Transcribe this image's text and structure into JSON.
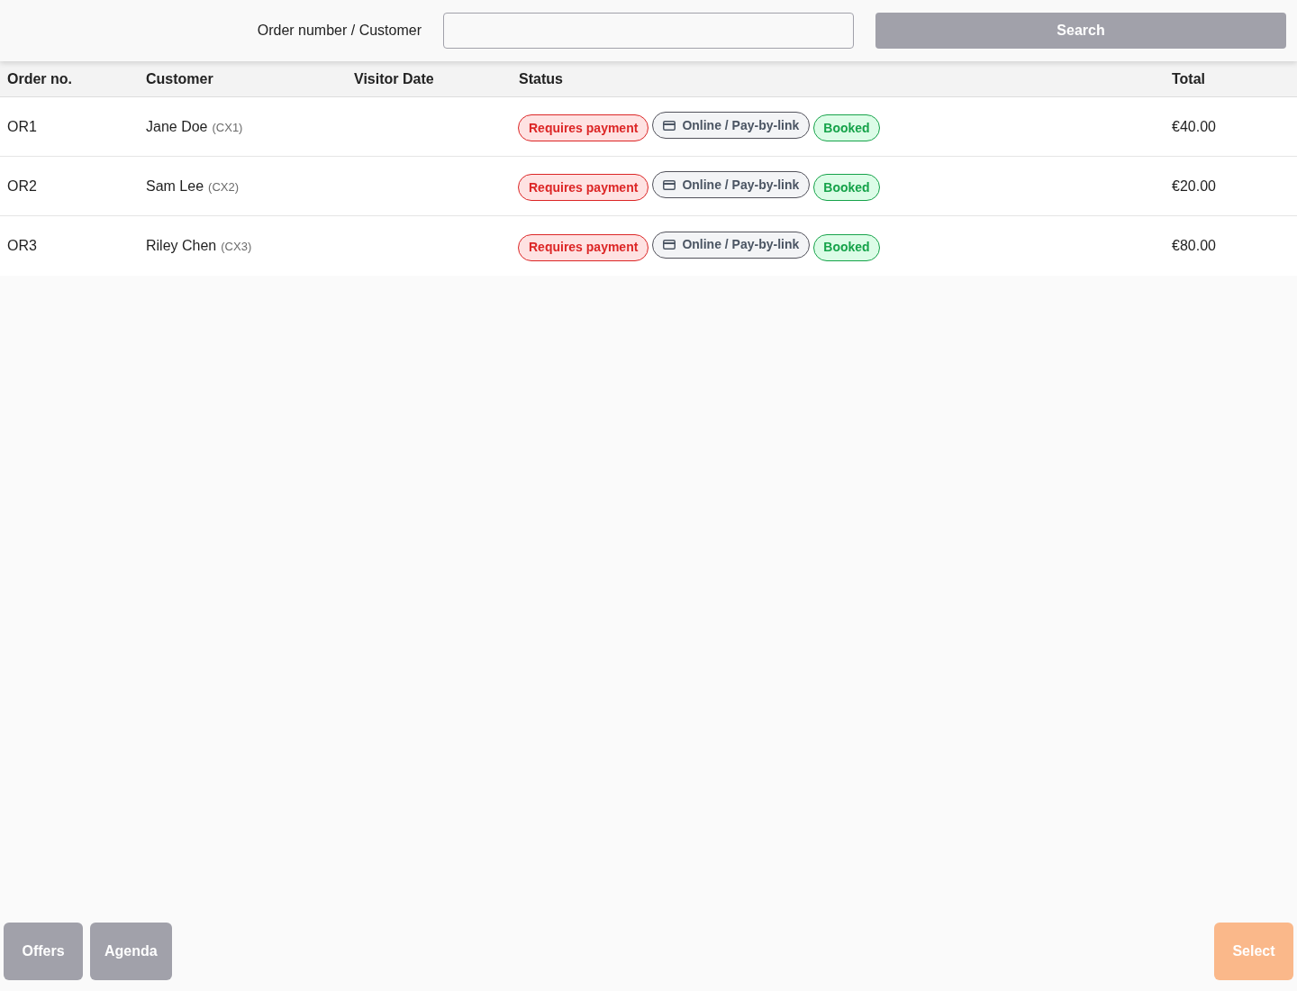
{
  "search_bar": {
    "label": "Order number / Customer",
    "button": "Search"
  },
  "table": {
    "columns": [
      "Order no.",
      "Customer",
      "Visitor Date",
      "Status",
      "Total"
    ],
    "rows": [
      {
        "order_no": "OR1",
        "customer": "Jane Doe",
        "customer_code": "(CX1)",
        "statuses": [
          {
            "kind": "payment",
            "label": "Requires payment"
          },
          {
            "kind": "method",
            "label": "Online / Pay-by-link"
          },
          {
            "kind": "booking",
            "label": "Booked"
          }
        ],
        "total": "€40.00"
      },
      {
        "order_no": "OR2",
        "customer": "Sam Lee",
        "customer_code": "(CX2)",
        "statuses": [
          {
            "kind": "payment",
            "label": "Requires payment"
          },
          {
            "kind": "method",
            "label": "Online / Pay-by-link"
          },
          {
            "kind": "booking",
            "label": "Booked"
          }
        ],
        "total": "€20.00"
      },
      {
        "order_no": "OR3",
        "customer": "Riley Chen",
        "customer_code": "(CX3)",
        "statuses": [
          {
            "kind": "payment",
            "label": "Requires payment"
          },
          {
            "kind": "method",
            "label": "Online / Pay-by-link"
          },
          {
            "kind": "booking",
            "label": "Booked"
          }
        ],
        "total": "€80.00"
      }
    ]
  },
  "footer": {
    "left_buttons": [
      "Offers",
      "Agenda"
    ],
    "right_button": "Select"
  }
}
